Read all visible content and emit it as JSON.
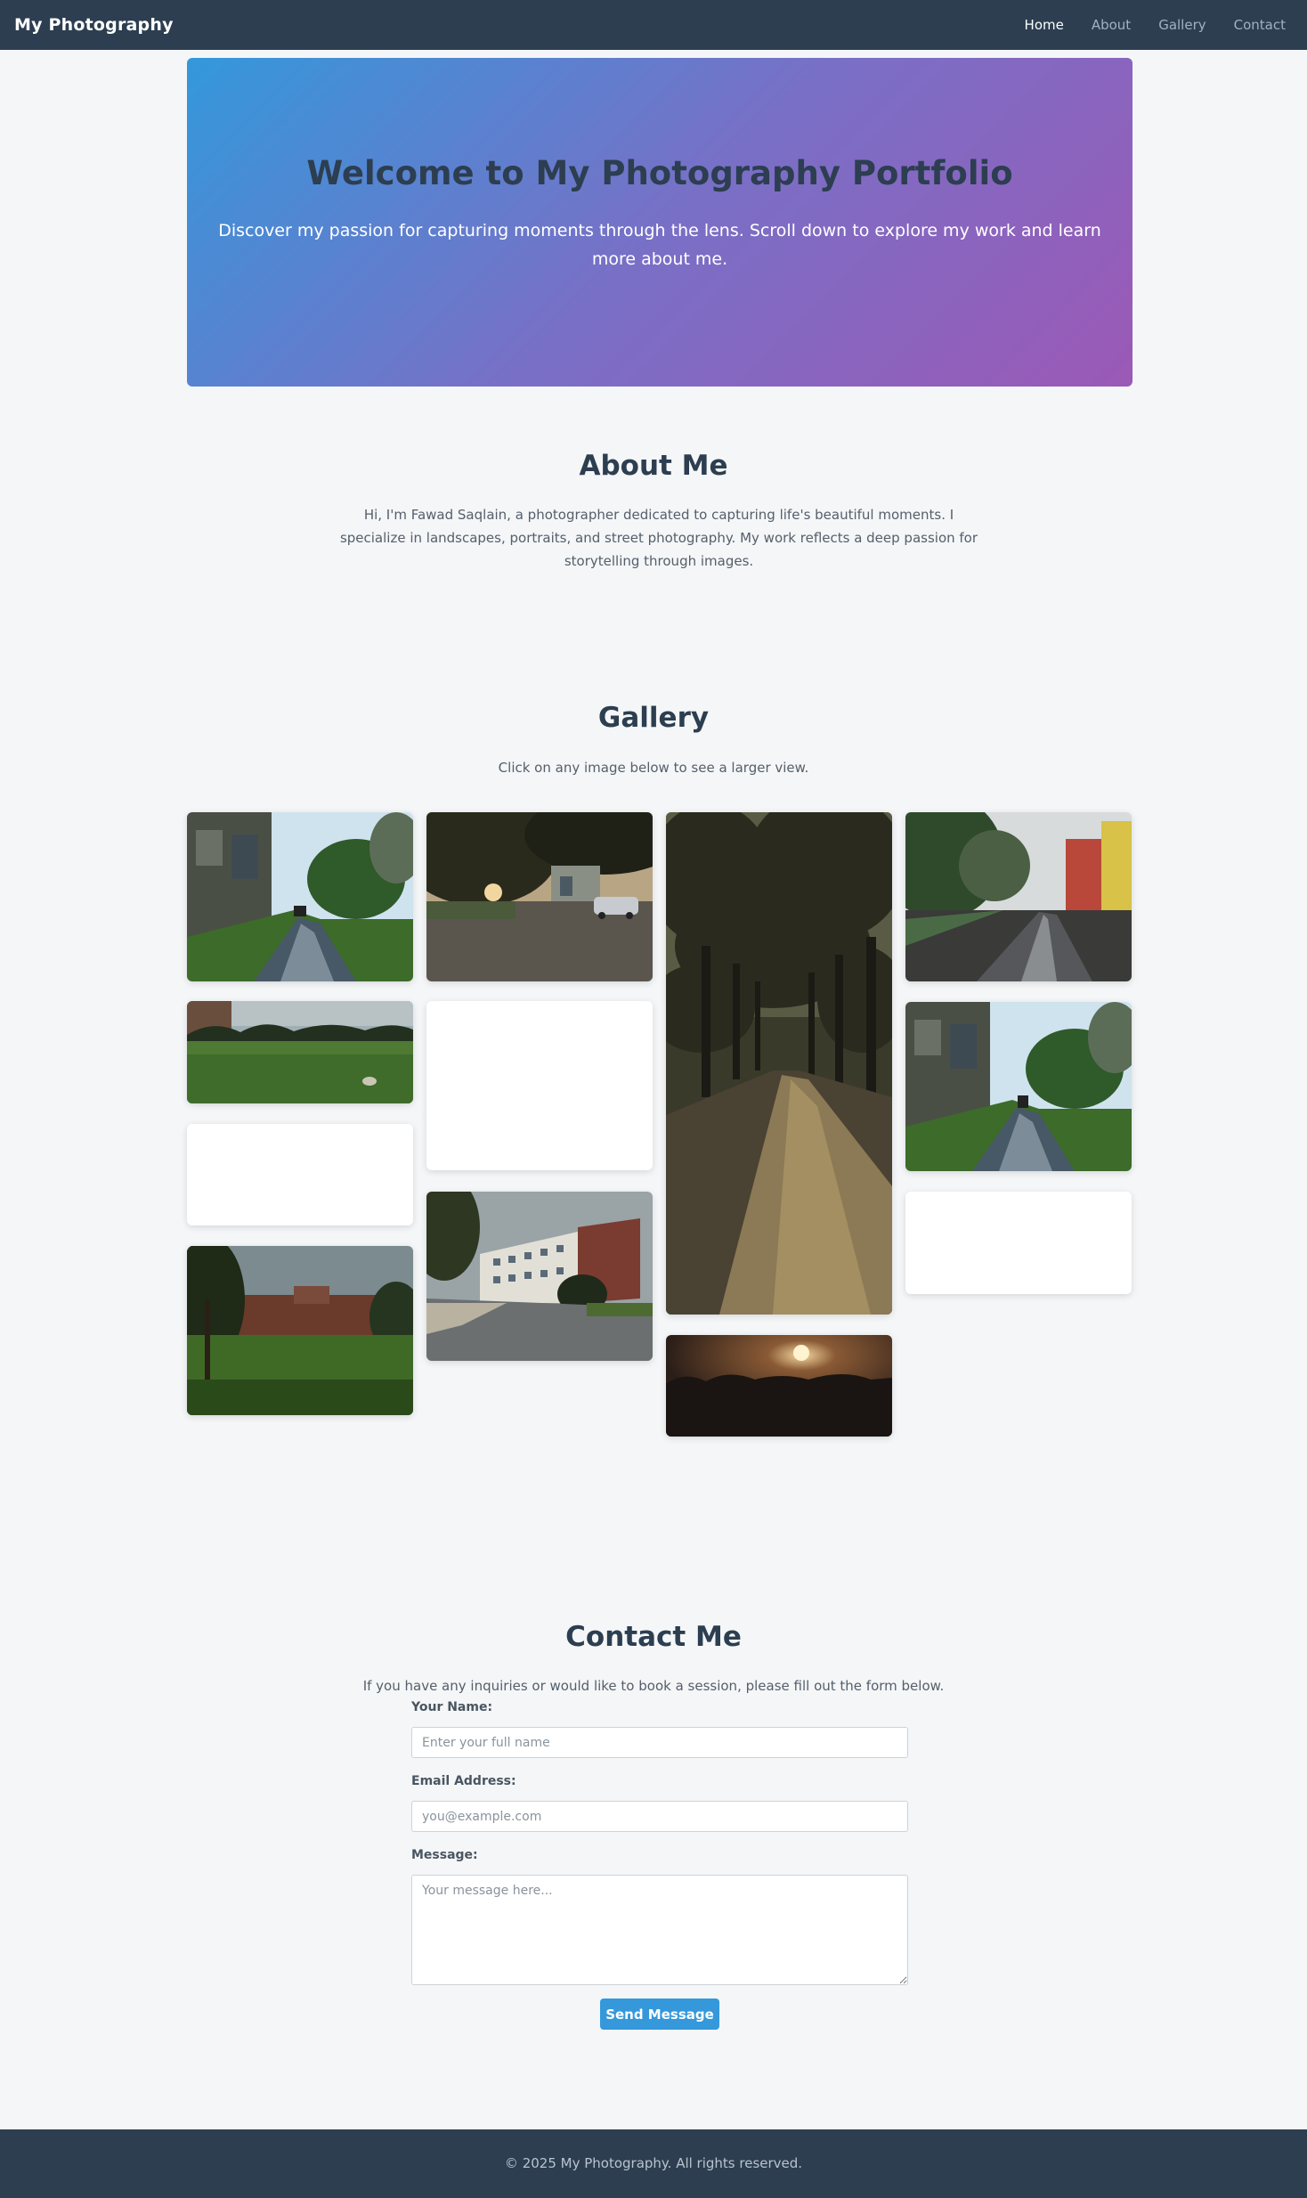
{
  "nav": {
    "brand": "My Photography",
    "links": [
      {
        "label": "Home",
        "active": true
      },
      {
        "label": "About",
        "active": false
      },
      {
        "label": "Gallery",
        "active": false
      },
      {
        "label": "Contact",
        "active": false
      }
    ]
  },
  "hero": {
    "title": "Welcome to My Photography Portfolio",
    "subtitle": "Discover my passion for capturing moments through the lens. Scroll down to explore my work and learn more about me."
  },
  "about": {
    "title": "About Me",
    "text": "Hi, I'm Fawad Saqlain, a photographer dedicated to capturing life's beautiful moments. I specialize in landscapes, portraits, and street photography. My work reflects a deep passion for storytelling through images."
  },
  "gallery": {
    "title": "Gallery",
    "subtitle": "Click on any image below to see a larger view.",
    "items": [
      {
        "scene": "wet-village-road"
      },
      {
        "scene": "green-field"
      },
      {
        "scene": "blank"
      },
      {
        "scene": "brick-building-lawn"
      },
      {
        "scene": "sunset-courtyard-car"
      },
      {
        "scene": "blank"
      },
      {
        "scene": "college-building"
      },
      {
        "scene": "tree-lined-path"
      },
      {
        "scene": "sunset-silhouette"
      },
      {
        "scene": "rainy-street"
      },
      {
        "scene": "wet-village-road"
      },
      {
        "scene": "blank"
      }
    ]
  },
  "contact": {
    "title": "Contact Me",
    "subtitle": "If you have any inquiries or would like to book a session, please fill out the form below.",
    "name_label": "Your Name:",
    "name_placeholder": "Enter your full name",
    "email_label": "Email Address:",
    "email_placeholder": "you@example.com",
    "message_label": "Message:",
    "message_placeholder": "Your message here...",
    "submit_label": "Send Message"
  },
  "footer": {
    "text": "© 2025 My Photography. All rights reserved."
  },
  "colors": {
    "nav_bg": "#2c3e50",
    "accent": "#3498db",
    "hero_gradient_start": "#3498db",
    "hero_gradient_end": "#9b59b6",
    "page_bg": "#f4f6f8"
  }
}
